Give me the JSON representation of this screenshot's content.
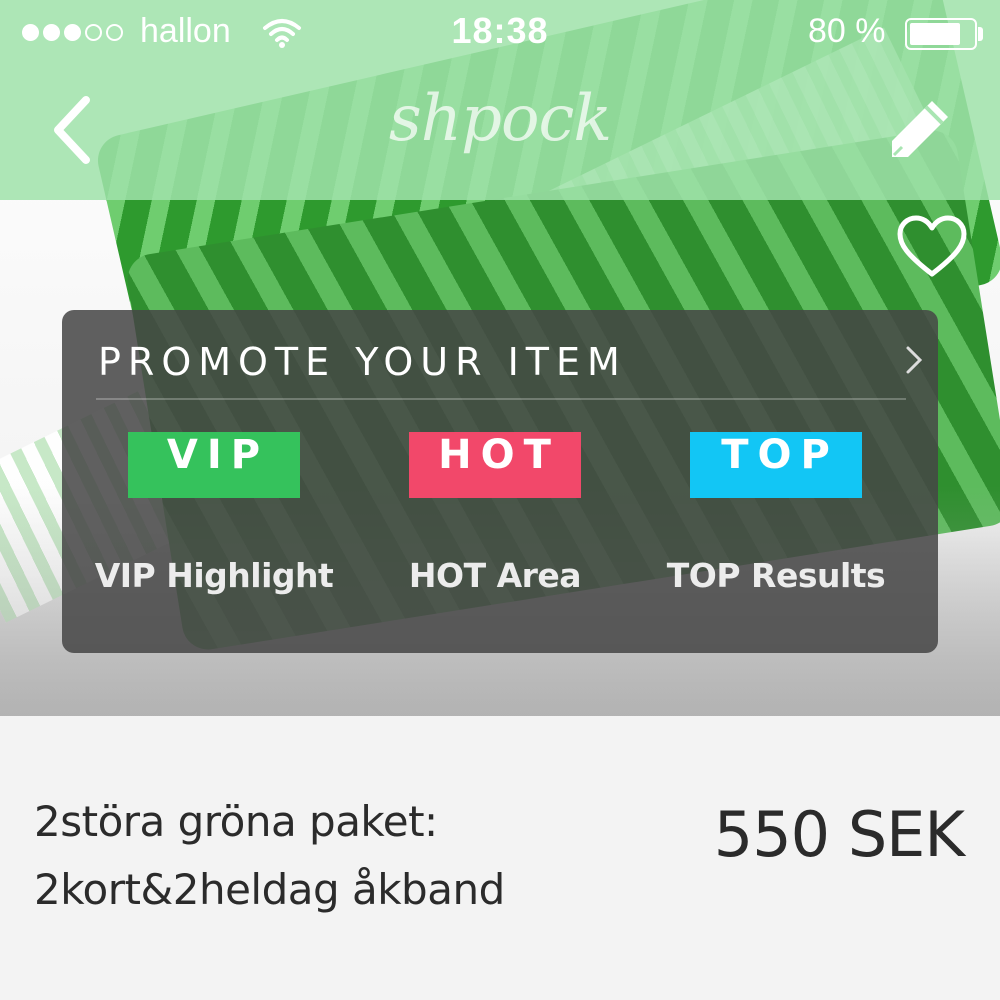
{
  "status_bar": {
    "carrier": "hallon",
    "time": "18:38",
    "battery_percent": "80 %",
    "battery_level": 0.8,
    "signal_bars_filled": 3,
    "signal_bars_total": 5
  },
  "nav": {
    "logo": "shpock",
    "back_icon": "back-chevron-icon",
    "edit_icon": "pencil-icon",
    "favorite_icon": "heart-outline-icon"
  },
  "promote": {
    "title": "PROMOTE YOUR ITEM",
    "options": [
      {
        "badge": "VIP",
        "label": "VIP Highlight",
        "color": "#35c25c"
      },
      {
        "badge": "HOT",
        "label": "HOT Area",
        "color": "#f2486a"
      },
      {
        "badge": "TOP",
        "label": "TOP Results",
        "color": "#12c6f5"
      }
    ]
  },
  "product": {
    "title_line1": "2störa gröna paket:",
    "title_line2": "2kort&2heldag åkband",
    "price": "550 SEK"
  },
  "colors": {
    "accent_green": "#a0e2aa"
  }
}
